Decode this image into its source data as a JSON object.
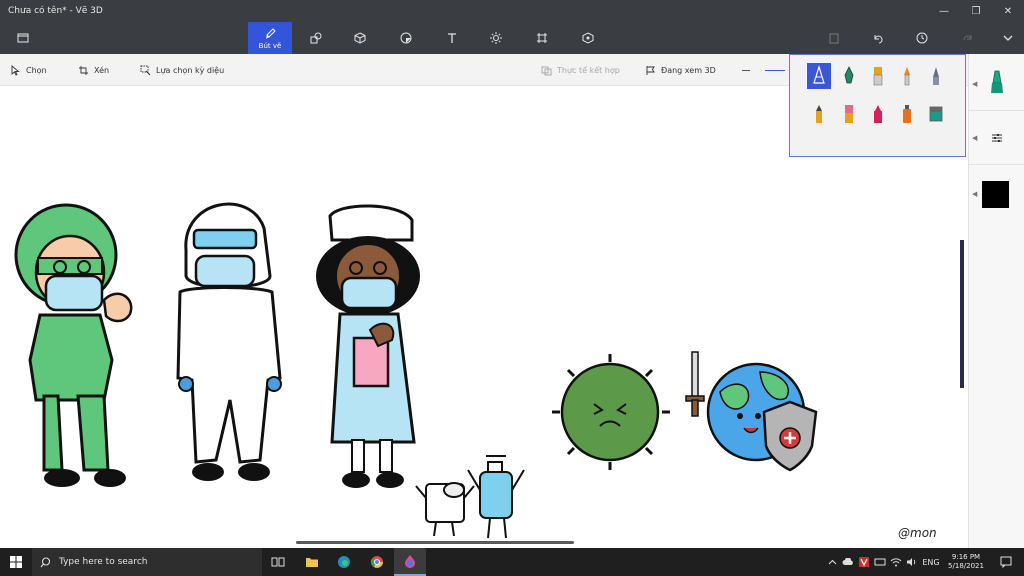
{
  "window": {
    "title": "Chưa có tên* - Vẽ 3D",
    "minimize_glyph": "—",
    "restore_glyph": "❐",
    "close_glyph": "✕"
  },
  "toolbar": {
    "brushes_label": "Bút vẽ",
    "tools": [
      "brushes",
      "2d-shapes",
      "3d-shapes",
      "stickers",
      "text",
      "effects",
      "canvas",
      "3d-library"
    ],
    "right_actions": [
      "paste",
      "undo",
      "history",
      "redo",
      "expand"
    ]
  },
  "subtoolbar": {
    "select_label": "Chọn",
    "crop_label": "Xén",
    "magic_select_label": "Lựa chọn kỳ diệu",
    "mixed_reality_label": "Thực tế kết hợp",
    "view_3d_label": "Đang xem 3D"
  },
  "brushes": [
    {
      "name": "marker-brush",
      "selected": true
    },
    {
      "name": "calligraphy-pen-brush"
    },
    {
      "name": "oil-brush"
    },
    {
      "name": "watercolor-brush"
    },
    {
      "name": "pixel-pen-brush"
    },
    {
      "name": "pencil-brush"
    },
    {
      "name": "eraser-brush"
    },
    {
      "name": "crayon-brush"
    },
    {
      "name": "spray-can-brush"
    },
    {
      "name": "fill-bucket-brush"
    }
  ],
  "right_panel": {
    "current_tool_icon": "marker-icon",
    "settings_icon": "sliders-icon",
    "active_color": "#000000"
  },
  "canvas": {
    "signature": "@mon"
  },
  "taskbar": {
    "search_placeholder": "Type here to search",
    "language": "ENG",
    "time": "9:16 PM",
    "date": "5/18/2021"
  },
  "colors": {
    "chrome": "#3a3d41",
    "accent": "#3355d8",
    "taskbar": "#1f1f1f"
  }
}
